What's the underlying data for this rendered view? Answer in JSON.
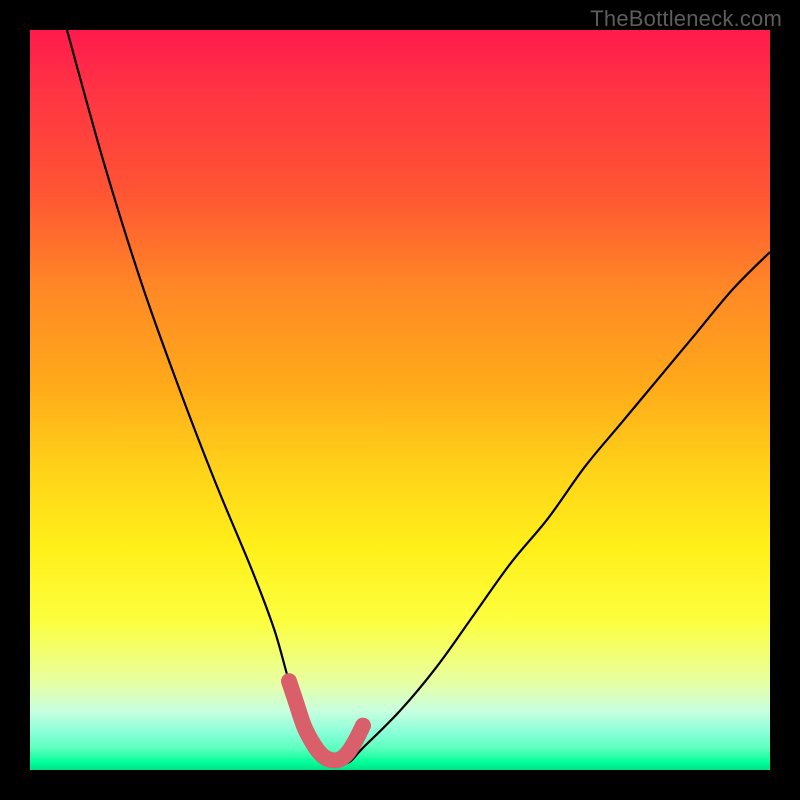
{
  "watermark": "TheBottleneck.com",
  "chart_data": {
    "type": "line",
    "title": "",
    "xlabel": "",
    "ylabel": "",
    "xlim": [
      0,
      100
    ],
    "ylim": [
      0,
      100
    ],
    "grid": false,
    "series": [
      {
        "name": "bottleneck-curve",
        "x": [
          5,
          10,
          15,
          20,
          25,
          30,
          33,
          35,
          37,
          39,
          41,
          43,
          45,
          50,
          55,
          60,
          65,
          70,
          75,
          80,
          85,
          90,
          95,
          100
        ],
        "y": [
          100,
          82,
          66,
          52,
          39,
          27,
          19,
          12,
          6,
          3,
          1,
          1,
          3,
          8,
          14,
          21,
          28,
          34,
          41,
          47,
          53,
          59,
          65,
          70
        ]
      },
      {
        "name": "optimal-marker",
        "x": [
          35,
          36,
          37,
          38,
          39,
          40,
          41,
          42,
          43,
          44,
          45
        ],
        "y": [
          12,
          9,
          6,
          4,
          2.5,
          1.6,
          1.3,
          1.5,
          2.4,
          4,
          6
        ]
      }
    ],
    "colors": {
      "curve": "#000000",
      "marker": "#d9606a"
    }
  }
}
